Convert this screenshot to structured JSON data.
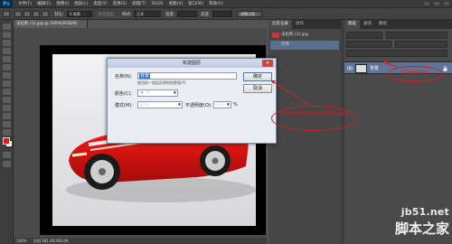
{
  "app": {
    "logo": "Ps"
  },
  "menubar": {
    "items": [
      "文件(F)",
      "编辑(E)",
      "图像(I)",
      "图层(L)",
      "类型(Y)",
      "选择(S)",
      "滤镜(T)",
      "3D(D)",
      "视图(V)",
      "窗口(W)",
      "帮助(H)"
    ]
  },
  "optionsbar": {
    "feather_label": "羽化:",
    "feather_value": "0 像素",
    "antialias_label": "消除锯齿",
    "style_label": "样式:",
    "style_value": "正常",
    "width_label": "宽度:",
    "height_label": "高度:",
    "refine_button": "调整边缘..."
  },
  "document": {
    "tab_title": "法拉利 (1).jpg @ 100%(RGB/8)",
    "status_zoom": "100%",
    "status_doc": "文档:381.4K/400.0K"
  },
  "history_panel": {
    "tabs": [
      "历史记录",
      "动作"
    ],
    "items": [
      "法拉利 (1).jpg",
      "打开"
    ]
  },
  "layers_panel": {
    "tabs": [
      "图层",
      "通道",
      "路径"
    ],
    "layer_name": "背景"
  },
  "dialog": {
    "title": "新建图层",
    "name_label": "名称(N):",
    "name_value": "背景",
    "hint": "使用前一图层创建剪贴蒙版(P)",
    "color_label": "颜色(C):",
    "color_value": "无",
    "mode_label": "模式(M):",
    "mode_value": "正常",
    "opacity_label": "不透明度(O):",
    "opacity_value": "100",
    "opacity_unit": "%",
    "ok_label": "确定",
    "cancel_label": "取消"
  },
  "annotations": {
    "left": "可以重新命名图层名或者直接点击确定",
    "right": "双击图层锁图标"
  },
  "watermark": {
    "url": "jb51.net",
    "brand": "脚本之家"
  },
  "colors": {
    "foreground": "#e11b1b",
    "background": "#ffffff",
    "annotation": "#d31f1f",
    "layer_selected": "#5d7596"
  }
}
